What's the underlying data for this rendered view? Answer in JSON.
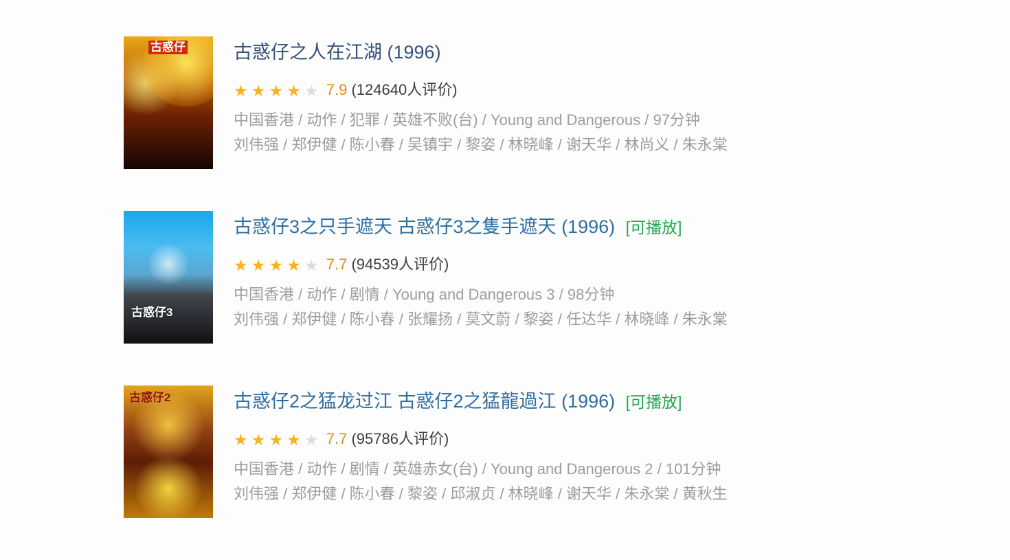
{
  "colors": {
    "title": "#35527a",
    "link_title": "#2f6ea0",
    "playable": "#1ea84f",
    "star": "#f8b31c",
    "score": "#e09012",
    "meta": "#9d9d9d"
  },
  "movies": [
    {
      "title": "古惑仔之人在江湖",
      "year": "(1996)",
      "playable_label": "",
      "rating": "7.9",
      "rating_count": "(124640人评价)",
      "stars_filled": 4,
      "meta": "中国香港 / 动作 / 犯罪 / 英雄不败(台) / Young and Dangerous / 97分钟",
      "cast": "刘伟强 / 郑伊健 / 陈小春 / 吴镇宇 / 黎姿 / 林晓峰 / 谢天华 / 林尚义 / 朱永棠",
      "poster_text": "古惑仔",
      "poster_icon": "movie-poster-icon"
    },
    {
      "title": "古惑仔3之只手遮天 古惑仔3之隻手遮天",
      "year": "(1996)",
      "playable_label": "[可播放]",
      "rating": "7.7",
      "rating_count": "(94539人评价)",
      "stars_filled": 4,
      "meta": "中国香港 / 动作 / 剧情 / Young and Dangerous 3 / 98分钟",
      "cast": "刘伟强 / 郑伊健 / 陈小春 / 张耀扬 / 莫文蔚 / 黎姿 / 任达华 / 林晓峰 / 朱永棠",
      "poster_text": "古惑仔3",
      "poster_icon": "movie-poster-icon"
    },
    {
      "title": "古惑仔2之猛龙过江 古惑仔2之猛龍過江",
      "year": "(1996)",
      "playable_label": "[可播放]",
      "rating": "7.7",
      "rating_count": "(95786人评价)",
      "stars_filled": 4,
      "meta": "中国香港 / 动作 / 剧情 / 英雄赤女(台) / Young and Dangerous 2 / 101分钟",
      "cast": "刘伟强 / 郑伊健 / 陈小春 / 黎姿 / 邱淑贞 / 林晓峰 / 谢天华 / 朱永棠 / 黄秋生",
      "poster_text": "古惑仔2",
      "poster_icon": "movie-poster-icon"
    }
  ]
}
